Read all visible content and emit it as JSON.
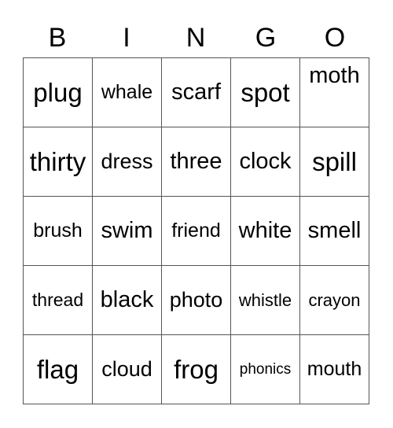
{
  "header": [
    "B",
    "I",
    "N",
    "G",
    "O"
  ],
  "rows": [
    [
      "plug",
      "whale",
      "scarf",
      "spot",
      "moth"
    ],
    [
      "thirty",
      "dress",
      "three",
      "clock",
      "spill"
    ],
    [
      "brush",
      "swim",
      "friend",
      "white",
      "smell"
    ],
    [
      "thread",
      "black",
      "photo",
      "whistle",
      "crayon"
    ],
    [
      "flag",
      "cloud",
      "frog",
      "phonics",
      "mouth"
    ]
  ]
}
